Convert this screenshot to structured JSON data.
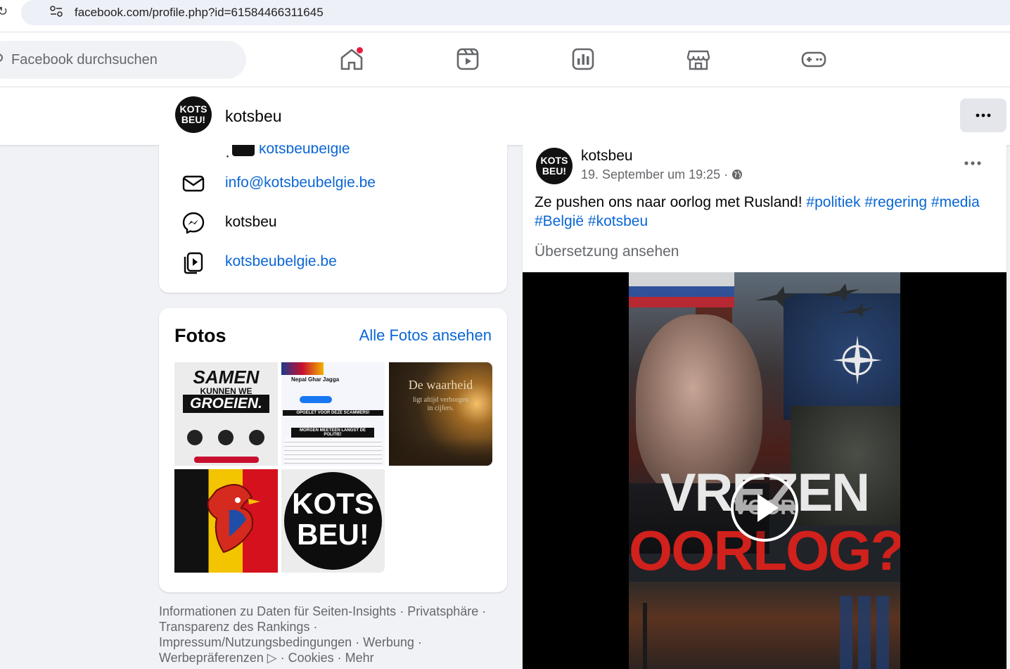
{
  "browser": {
    "url": "facebook.com/profile.php?id=61584466311645"
  },
  "topnav": {
    "search_placeholder": "Facebook durchsuchen",
    "icons": [
      "home-icon",
      "reels-icon",
      "dashboard-icon",
      "marketplace-icon",
      "gaming-icon"
    ]
  },
  "profile": {
    "name": "kotsbeu",
    "avatar_text_line1": "KOTS",
    "avatar_text_line2": "BEU!"
  },
  "intro": {
    "partial_link": "kotsbeubelgie",
    "email": "info@kotsbeubelgie.be",
    "messenger": "kotsbeu",
    "website": "kotsbeubelgie.be"
  },
  "fotos": {
    "title": "Fotos",
    "see_all": "Alle Fotos ansehen",
    "photos": [
      {
        "lines": [
          "SAMEN",
          "KUNNEN WE",
          "GROEIEN."
        ]
      },
      {
        "lines": [
          "Nepal Ghar Jagga",
          "OPGELET VOOR DEZE SCAMMERS!",
          "MORGEN MEETEEN LANGST DE POLITIE!"
        ]
      },
      {
        "lines": [
          "De waarheid",
          "ligt altijd verborgen",
          "in cijfers."
        ]
      },
      {
        "lines": []
      },
      {
        "lines": [
          "KOTS",
          "BEU!"
        ]
      }
    ]
  },
  "footer": {
    "links": [
      "Informationen zu Daten für Seiten-Insights",
      "Privatsphäre",
      "Transparenz des Rankings",
      "Impressum/Nutzungsbedingungen",
      "Werbung",
      "Werbepräferenzen",
      "Cookies",
      "Mehr"
    ]
  },
  "post": {
    "author": "kotsbeu",
    "date": "19. September um 19:25",
    "text_plain": "Ze pushen ons naar oorlog met Rusland! ",
    "hashtags": [
      "#politiek",
      "#regering",
      "#media",
      "#België",
      "#kotsbeu"
    ],
    "translate": "Übersetzung ansehen",
    "video_title_line1": "VREZEN",
    "video_title_line2": "VOOR",
    "video_title_line3": "OORLOG?"
  },
  "colors": {
    "link": "#0a66d4",
    "notification": "#e41e3f",
    "secondary_text": "#65676b"
  }
}
